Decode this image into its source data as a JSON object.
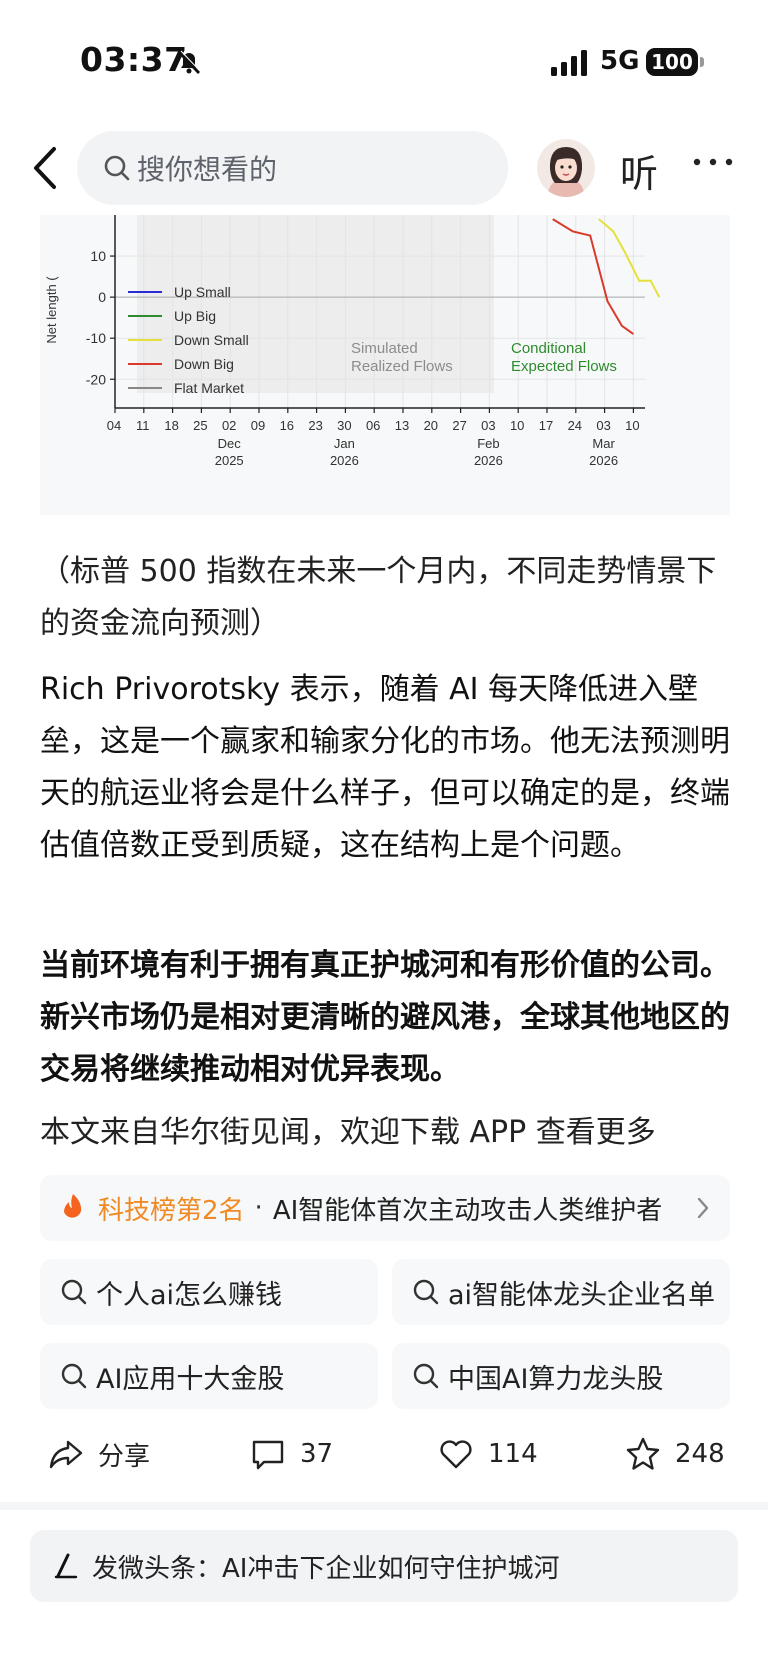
{
  "status": {
    "time": "03:37",
    "network": "5G",
    "battery": "100"
  },
  "nav": {
    "search_placeholder": "搜你想看的",
    "listen_label": "听"
  },
  "chart_data": {
    "type": "line",
    "ylabel": "Net length (",
    "yticks": [
      10,
      0,
      -10,
      -20
    ],
    "ylim": [
      -27,
      20
    ],
    "x_ticks": [
      "04",
      "11",
      "18",
      "25",
      "02",
      "09",
      "16",
      "23",
      "30",
      "06",
      "13",
      "20",
      "27",
      "03",
      "10",
      "17",
      "24",
      "03",
      "10"
    ],
    "x_groups": [
      {
        "month": "Dec",
        "year": "2025"
      },
      {
        "month": "Jan",
        "year": "2026"
      },
      {
        "month": "Feb",
        "year": "2026"
      },
      {
        "month": "Mar",
        "year": "2026"
      }
    ],
    "legend": [
      "Up Small",
      "Up Big",
      "Down Small",
      "Down Big",
      "Flat Market"
    ],
    "legend_colors": [
      "#2b2bd6",
      "#2e8b2e",
      "#e6e03a",
      "#d93a2b",
      "#888888"
    ],
    "annotations": [
      {
        "text": "Simulated\nRealized Flows",
        "color": "#8c8c8c"
      },
      {
        "text": "Conditional\nExpected Flows",
        "color": "#2e8b2e"
      }
    ],
    "series": [
      {
        "name": "Down Big",
        "x_index": [
          15.2,
          15.9,
          16.5,
          17.1,
          17.6,
          18.0
        ],
        "values": [
          19,
          16,
          15,
          -1,
          -7,
          -9
        ]
      },
      {
        "name": "Down Small",
        "x_index": [
          16.8,
          17.3,
          17.7,
          18.2,
          18.6,
          18.9
        ],
        "values": [
          19,
          16,
          11,
          4,
          4,
          0
        ]
      }
    ]
  },
  "article": {
    "caption": "（标普 500 指数在未来一个月内，不同走势情景下的资金流向预测）",
    "p1": "Rich Privorotsky 表示，随着 AI 每天降低进入壁垒，这是一个赢家和输家分化的市场。他无法预测明天的航运业将会是什么样子，但可以确定的是，终端估值倍数正受到质疑，这在结构上是个问题。",
    "p2": "当前环境有利于拥有真正护城河和有形价值的公司。新兴市场仍是相对更清晰的避风港，全球其他地区的交易将继续推动相对优异表现。",
    "p3": "本文来自华尔街见闻，欢迎下载 APP 查看更多"
  },
  "hot_rank": {
    "label": "科技榜第2名",
    "dot": "·",
    "text": "AI智能体首次主动攻击人类维护者",
    "color": "#f08a24"
  },
  "suggestions": [
    "个人ai怎么赚钱",
    "ai智能体龙头企业名单",
    "AI应用十大金股",
    "中国AI算力龙头股"
  ],
  "actions": {
    "share": "分享",
    "comments": "37",
    "likes": "114",
    "favorites": "248"
  },
  "post_bar": {
    "text": "发微头条：AI冲击下企业如何守住护城河"
  }
}
